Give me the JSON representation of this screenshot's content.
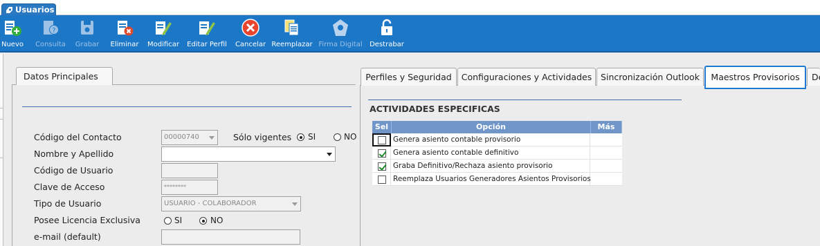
{
  "window": {
    "tab_title": "Usuarios"
  },
  "toolbar": {
    "buttons": [
      {
        "label": "Nuevo",
        "icon": "new-user-icon",
        "enabled": true
      },
      {
        "label": "Consulta",
        "icon": "query-icon",
        "enabled": false
      },
      {
        "label": "Grabar",
        "icon": "save-icon",
        "enabled": false
      },
      {
        "label": "Eliminar",
        "icon": "delete-icon",
        "enabled": true
      },
      {
        "label": "Modificar",
        "icon": "edit-icon",
        "enabled": true
      },
      {
        "label": "Editar Perfil",
        "icon": "edit-profile-icon",
        "enabled": true
      },
      {
        "label": "Cancelar",
        "icon": "cancel-icon",
        "enabled": true
      },
      {
        "label": "Reemplazar",
        "icon": "replace-icon",
        "enabled": true
      },
      {
        "label": "Firma Digital",
        "icon": "digital-signature-icon",
        "enabled": false
      },
      {
        "label": "Destrabar",
        "icon": "unlock-icon",
        "enabled": true
      }
    ]
  },
  "left_panel": {
    "tab_label": "Datos Principales",
    "fields": {
      "codigo_contacto": {
        "label": "Código del Contacto",
        "value": "00000740"
      },
      "solo_vigentes": {
        "label": "Sólo vigentes",
        "opt_si": "SI",
        "opt_no": "NO",
        "selected": "SI"
      },
      "nombre_apellido": {
        "label": "Nombre y Apellido",
        "value": ""
      },
      "codigo_usuario": {
        "label": "Código de Usuario",
        "value": ""
      },
      "clave_acceso": {
        "label": "Clave de Acceso",
        "value": "********"
      },
      "tipo_usuario": {
        "label": "Tipo de Usuario",
        "value": "USUARIO - COLABORADOR"
      },
      "licencia_exclusiva": {
        "label": "Posee Licencia Exclusiva",
        "opt_si": "SI",
        "opt_no": "NO",
        "selected": "NO"
      },
      "email": {
        "label": "e-mail (default)",
        "value": ""
      }
    }
  },
  "right_panel": {
    "tabs": [
      {
        "label": "Perfiles y Seguridad",
        "active": false
      },
      {
        "label": "Configuraciones y Actividades",
        "active": false
      },
      {
        "label": "Sincronización Outlook",
        "active": false
      },
      {
        "label": "Maestros Provisorios",
        "active": true
      },
      {
        "label": "De",
        "active": false
      }
    ],
    "section_title": "ACTIVIDADES ESPECIFICAS",
    "grid": {
      "headers": {
        "sel": "Sel",
        "opcion": "Opción",
        "mas": "Más"
      },
      "rows": [
        {
          "opcion": "Genera asiento contable provisorio",
          "checked": false
        },
        {
          "opcion": "Genera asiento contable definitivo",
          "checked": true
        },
        {
          "opcion": "Graba Definitivo/Rechaza asiento provisorio",
          "checked": true
        },
        {
          "opcion": "Reemplaza Usuarios Generadores Asientos Provisorios",
          "checked": false
        }
      ]
    }
  },
  "colors": {
    "toolbar_bg": "#1d77c7",
    "active_tab_border": "#1f78d1",
    "grid_header": "#6f95c9",
    "check_green": "#1b8a2a"
  }
}
